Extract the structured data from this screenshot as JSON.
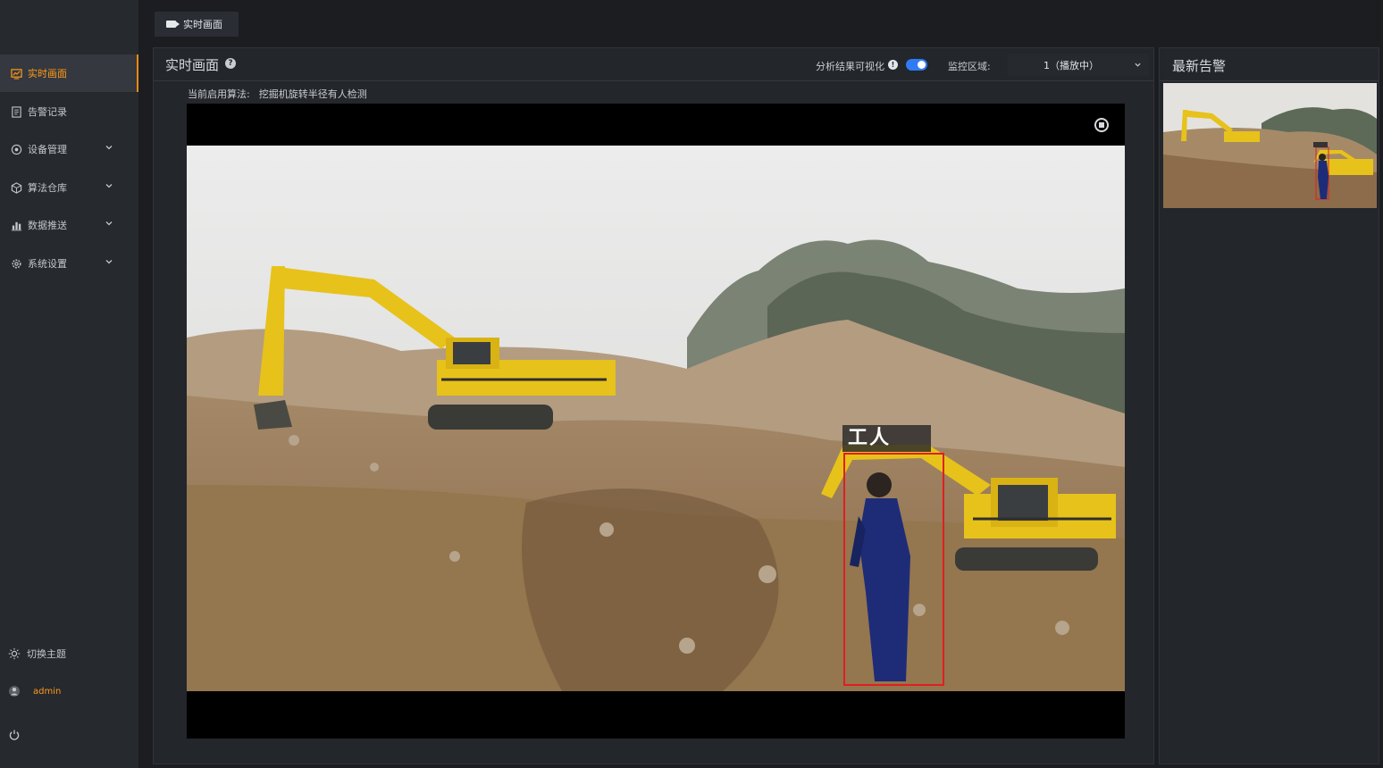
{
  "sidebar": {
    "items": [
      {
        "label": "实时画面",
        "icon": "monitor-chart-icon",
        "active": true,
        "has_submenu": false
      },
      {
        "label": "告警记录",
        "icon": "document-list-icon",
        "active": false,
        "has_submenu": false
      },
      {
        "label": "设备管理",
        "icon": "device-target-icon",
        "active": false,
        "has_submenu": true
      },
      {
        "label": "算法仓库",
        "icon": "algorithm-cube-icon",
        "active": false,
        "has_submenu": true
      },
      {
        "label": "数据推送",
        "icon": "bar-chart-icon",
        "active": false,
        "has_submenu": true
      },
      {
        "label": "系统设置",
        "icon": "gear-icon",
        "active": false,
        "has_submenu": true
      }
    ],
    "bottom": {
      "theme_label": "切换主题",
      "user_name": "admin"
    }
  },
  "tabs": [
    {
      "label": "实时画面",
      "icon": "camera-icon"
    }
  ],
  "main": {
    "title": "实时画面",
    "viz_label": "分析结果可视化",
    "viz_enabled": true,
    "zone_label": "监控区域:",
    "zone_value": "1（播放中）",
    "algo_label": "当前启用算法:",
    "algo_value": "挖掘机旋转半径有人检测",
    "detection_label": "工人"
  },
  "alerts": {
    "title": "最新告警"
  },
  "colors": {
    "accent": "#ff9a1a",
    "toggle_on": "#2f7bf5",
    "detection_box": "#e01f1f",
    "excavator": "#e7c21a"
  }
}
